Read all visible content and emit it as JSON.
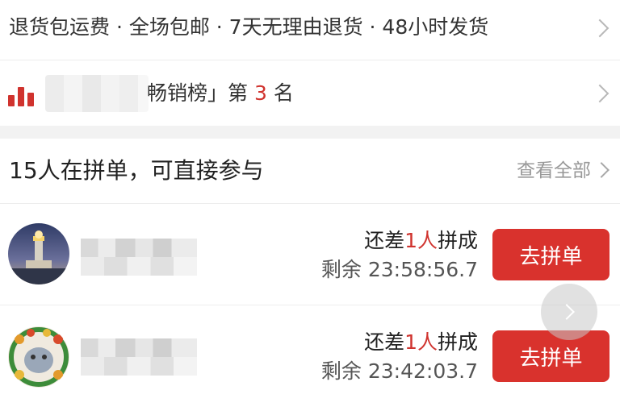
{
  "service_bar": {
    "text": "退货包运费 · 全场包邮 · 7天无理由退货 · 48小时发货"
  },
  "ranking": {
    "label_prefix": "畅销榜」第",
    "rank": "3",
    "label_suffix": "名"
  },
  "group_buy": {
    "title": "15人在拼单，可直接参与",
    "view_all": "查看全部",
    "items": [
      {
        "need_prefix": "还差",
        "need_count": "1人",
        "need_suffix": "拼成",
        "remaining": "剩余 23:58:56.7",
        "button": "去拼单"
      },
      {
        "need_prefix": "还差",
        "need_count": "1人",
        "need_suffix": "拼成",
        "remaining": "剩余 23:42:03.7",
        "button": "去拼单"
      }
    ]
  },
  "colors": {
    "accent": "#d9322d",
    "muted": "#999999",
    "band": "#f2f2f2"
  },
  "icons": {
    "ranking": "bar-chart-icon",
    "navigate": "chevron-right-icon"
  }
}
